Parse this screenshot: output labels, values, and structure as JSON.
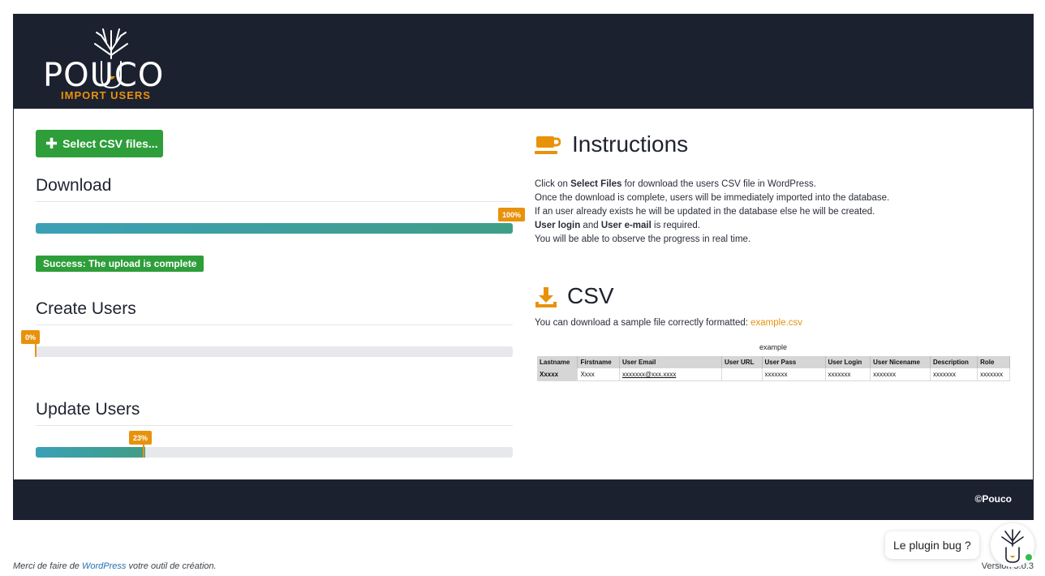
{
  "header": {
    "logo_word": "POUCO",
    "logo_sub": "IMPORT USERS"
  },
  "left": {
    "select_button": "Select CSV files...",
    "download": {
      "title": "Download",
      "percent_label": "100%",
      "progress": 1.0,
      "status": "Success: The upload is complete"
    },
    "create": {
      "title": "Create Users",
      "percent_label": "0%",
      "progress": 0.0
    },
    "update": {
      "title": "Update Users",
      "percent_label": "23%",
      "progress": 0.23
    }
  },
  "instructions": {
    "title": "Instructions",
    "line1_pre": "Click on ",
    "line1_bold": "Select Files",
    "line1_post": " for download the users CSV file in WordPress.",
    "line2": "Once the download is complete, users will be immediately imported into the database.",
    "line3": "If an user already exists he will be updated in the database else he will be created.",
    "line4_bold1": "User login",
    "line4_mid": " and ",
    "line4_bold2": "User e-mail",
    "line4_post": " is required.",
    "line5": "You will be able to observe the progress in real time."
  },
  "csv": {
    "title": "CSV",
    "text": "You can download a sample file correctly formatted: ",
    "link": "example.csv",
    "example_caption": "example",
    "columns": [
      "Lastname",
      "Firstname",
      "User Email",
      "User URL",
      "User Pass",
      "User Login",
      "User Nicename",
      "Description",
      "Role"
    ],
    "row": [
      "Xxxxx",
      "Xxxx",
      "xxxxxxx@xxx.xxxx",
      "",
      "xxxxxxx",
      "xxxxxxx",
      "xxxxxxx",
      "xxxxxxx",
      "xxxxxxx"
    ]
  },
  "footer": {
    "copyright": "©Pouco"
  },
  "wp": {
    "credit_pre": "Merci de faire de ",
    "credit_link": "WordPress",
    "credit_post": " votre outil de création.",
    "version": "Version 5.0.3"
  },
  "help": {
    "bubble": "Le plugin bug ?"
  },
  "colors": {
    "accent": "#e8920c",
    "success": "#2e9e3a",
    "dark": "#1c2130",
    "progress": "#3ba0b5"
  }
}
